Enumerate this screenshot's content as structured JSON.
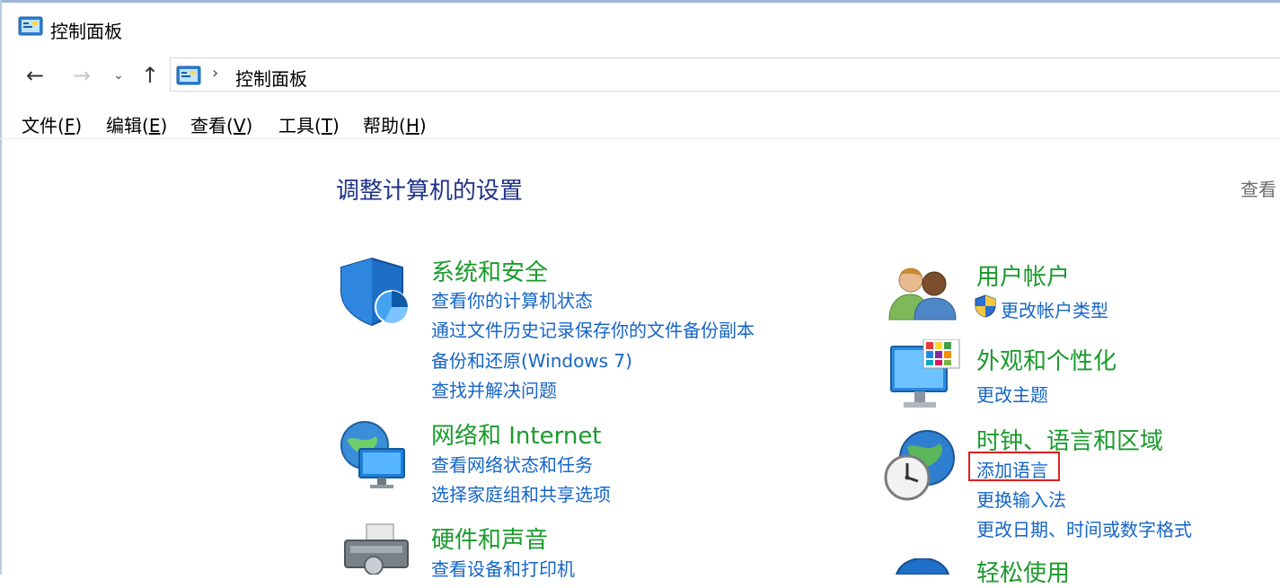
{
  "window": {
    "title": "控制面板"
  },
  "nav": {
    "back_glyph": "←",
    "forward_glyph": "→",
    "recent_glyph": "⌄",
    "up_glyph": "↑",
    "address_sep": "›",
    "address_crumb": "控制面板"
  },
  "menu": [
    {
      "label": "文件(",
      "key": "F",
      "close": ")"
    },
    {
      "label": "编辑(",
      "key": "E",
      "close": ")"
    },
    {
      "label": "查看(",
      "key": "V",
      "close": ")"
    },
    {
      "label": "工具(",
      "key": "T",
      "close": ")"
    },
    {
      "label": "帮助(",
      "key": "H",
      "close": ")"
    }
  ],
  "content": {
    "title": "调整计算机的设置",
    "view_by": "查看",
    "categories": {
      "security": {
        "title": "系统和安全",
        "links": [
          "查看你的计算机状态",
          "通过文件历史记录保存你的文件备份副本",
          "备份和还原(Windows 7)",
          "查找并解决问题"
        ]
      },
      "network": {
        "title": "网络和 Internet",
        "links": [
          "查看网络状态和任务",
          "选择家庭组和共享选项"
        ]
      },
      "hardware": {
        "title": "硬件和声音",
        "links": [
          "查看设备和打印机"
        ]
      },
      "accounts": {
        "title": "用户帐户",
        "links": [
          "更改帐户类型"
        ]
      },
      "appearance": {
        "title": "外观和个性化",
        "links": [
          "更改主题"
        ]
      },
      "clock": {
        "title": "时钟、语言和区域",
        "links": [
          "添加语言",
          "更换输入法",
          "更改日期、时间或数字格式"
        ]
      },
      "ease": {
        "title": "轻松使用"
      }
    }
  },
  "colors": {
    "category_title": "#1a9a2c",
    "link": "#1565c8",
    "page_title": "#1e3287",
    "highlight_box": "#e02020"
  }
}
